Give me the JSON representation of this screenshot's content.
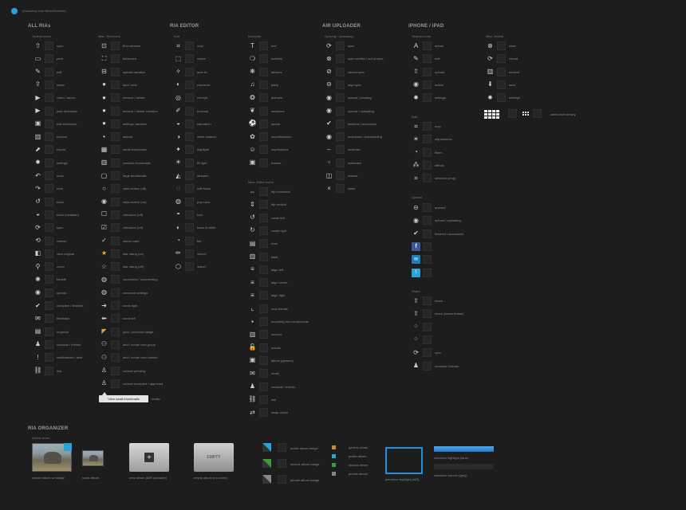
{
  "brand": {
    "logo_text": "photoshop.com Beta Elements",
    "accent": "#2aa3d8"
  },
  "sections": {
    "all_rias": "ALL RIAs",
    "ria_editor": "RIA EDITOR",
    "air_uploader": "AIR UPLOADER",
    "iphone_ipad": "iPHONE / iPAD",
    "ria_organizer": "RIA ORGANIZER"
  },
  "subsections": {
    "toolbar_icons": "Toolbar Icons",
    "misc_ria_icons": "Misc. RIA Icons",
    "edit": "Edit",
    "decorate": "Decorate",
    "misc_editor_icons": "Misc. Editor Icons",
    "syncing_uploading": "Syncing / Uploading",
    "iphone_toolbar_icons": "Toolbar Icons",
    "misc_mobile": "Misc. Mobile",
    "iphone_edit": "Edit",
    "iphone_upload": "Upload",
    "iphone_share": "Share",
    "album_icons": "Album Icons"
  },
  "toolbar_icons": [
    {
      "icon": "upload",
      "label": "sync"
    },
    {
      "icon": "print",
      "label": "print"
    },
    {
      "icon": "edit",
      "label": "edit"
    },
    {
      "icon": "share",
      "label": "share"
    },
    {
      "icon": "video-demo",
      "label": "video / demo"
    },
    {
      "icon": "play-slideshow",
      "label": "play slideshow"
    },
    {
      "icon": "edit-slideshow",
      "label": "edit slideshow"
    },
    {
      "icon": "remove",
      "label": "remove"
    },
    {
      "icon": "export",
      "label": "export"
    },
    {
      "icon": "settings",
      "label": "settings"
    },
    {
      "icon": "undo",
      "label": "undo"
    },
    {
      "icon": "redo",
      "label": "redo"
    },
    {
      "icon": "reset",
      "label": "reset"
    },
    {
      "icon": "reset-variation",
      "label": "reset (variation)"
    },
    {
      "icon": "sync",
      "label": "sync"
    },
    {
      "icon": "refresh",
      "label": "refresh"
    },
    {
      "icon": "view-original",
      "label": "view original"
    },
    {
      "icon": "zoom",
      "label": "zoom"
    },
    {
      "icon": "benefit",
      "label": "benefit"
    },
    {
      "icon": "upload-pending",
      "label": "upload"
    },
    {
      "icon": "complete",
      "label": "complete / finished"
    },
    {
      "icon": "feedback",
      "label": "feedback"
    },
    {
      "icon": "organize",
      "label": "organize"
    },
    {
      "icon": "contacts",
      "label": "contacts / friends"
    },
    {
      "icon": "notifications",
      "label": "notifications / alert"
    },
    {
      "icon": "link",
      "label": "link"
    }
  ],
  "misc_ria_icons": [
    {
      "icon": "fit-to-window",
      "label": "fit to window"
    },
    {
      "icon": "fullscreen",
      "label": "fullscreen"
    },
    {
      "icon": "upload-variation",
      "label": "upload variation"
    },
    {
      "icon": "add-new",
      "label": "add / new"
    },
    {
      "icon": "remove-delete",
      "label": "remove / delete"
    },
    {
      "icon": "remove-delete-variation",
      "label": "remove / delete variation"
    },
    {
      "icon": "settings-variation",
      "label": "settings variation"
    },
    {
      "icon": "search",
      "label": "search"
    },
    {
      "icon": "small-thumbnails",
      "label": "small thumbnails"
    },
    {
      "icon": "medium-thumbnails",
      "label": "medium thumbnails"
    },
    {
      "icon": "large-thumbnails",
      "label": "large thumbnails"
    },
    {
      "icon": "radio-button-off",
      "label": "radio button (off)"
    },
    {
      "icon": "radio-button-on",
      "label": "radio button (on)"
    },
    {
      "icon": "checkbox-off",
      "label": "checkbox (off)"
    },
    {
      "icon": "checkbox-on",
      "label": "checkbox (on)"
    },
    {
      "icon": "check-mark",
      "label": "check mark"
    },
    {
      "icon": "star-rating-on",
      "label": "star rating (on)"
    },
    {
      "icon": "star-rating-off",
      "label": "star rating (off)"
    },
    {
      "icon": "comments",
      "label": "comments / commenting"
    },
    {
      "icon": "comment-settings",
      "label": "comment settings"
    },
    {
      "icon": "scroll-right",
      "label": "scroll right"
    },
    {
      "icon": "scroll-left",
      "label": "scroll left"
    },
    {
      "icon": "plus-premium-badge",
      "label": "plus / premium badge"
    },
    {
      "icon": "add-create-group",
      "label": "add / create new group"
    },
    {
      "icon": "add-create-contact",
      "label": "add / create new contact"
    },
    {
      "icon": "contact-pending",
      "label": "contact pending"
    },
    {
      "icon": "contact-accepted",
      "label": "contact accepted / approved"
    }
  ],
  "edit_icons": [
    {
      "icon": "crop",
      "label": "crop"
    },
    {
      "icon": "resize",
      "label": "resize"
    },
    {
      "icon": "auto-fix",
      "label": "auto fix"
    },
    {
      "icon": "exposure",
      "label": "exposure"
    },
    {
      "icon": "red-eye",
      "label": "red eye"
    },
    {
      "icon": "touchup",
      "label": "touchup"
    },
    {
      "icon": "saturation",
      "label": "saturation"
    },
    {
      "icon": "white-balance",
      "label": "white balance"
    },
    {
      "icon": "highlight",
      "label": "highlight"
    },
    {
      "icon": "fill-light",
      "label": "fill light"
    },
    {
      "icon": "sharpen",
      "label": "sharpen"
    },
    {
      "icon": "soft-focus",
      "label": "soft focus"
    },
    {
      "icon": "pop-color",
      "label": "pop color"
    },
    {
      "icon": "hue",
      "label": "hue"
    },
    {
      "icon": "black-white",
      "label": "black & white"
    },
    {
      "icon": "tint",
      "label": "tint"
    },
    {
      "icon": "sketch",
      "label": "sketch"
    },
    {
      "icon": "distort",
      "label": "distort"
    }
  ],
  "decorate_icons": [
    {
      "icon": "text",
      "label": "text"
    },
    {
      "icon": "bubbles",
      "label": "bubbles"
    },
    {
      "icon": "stickers",
      "label": "stickers"
    },
    {
      "icon": "party",
      "label": "party"
    },
    {
      "icon": "animals",
      "label": "animals"
    },
    {
      "icon": "seafarms",
      "label": "seafarms"
    },
    {
      "icon": "sports",
      "label": "sports"
    },
    {
      "icon": "miscellaneous",
      "label": "miscellaneous"
    },
    {
      "icon": "expressions",
      "label": "expressions"
    },
    {
      "icon": "frames",
      "label": "frames"
    }
  ],
  "misc_editor_icons": [
    {
      "icon": "flip-horizontal",
      "label": "flip horizontal"
    },
    {
      "icon": "flip-vertical",
      "label": "flip vertical"
    },
    {
      "icon": "rotate-left",
      "label": "rotate left"
    },
    {
      "icon": "rotate-right",
      "label": "rotate right"
    },
    {
      "icon": "front",
      "label": "front"
    },
    {
      "icon": "back",
      "label": "back"
    },
    {
      "icon": "align-left",
      "label": "align left"
    },
    {
      "icon": "align-center",
      "label": "align center"
    },
    {
      "icon": "align-right",
      "label": "align right"
    },
    {
      "icon": "crop-handle",
      "label": "crop handle"
    },
    {
      "icon": "bounding-box",
      "label": "bounding box components"
    },
    {
      "icon": "remove",
      "label": "remove"
    },
    {
      "icon": "unlock",
      "label": "unlock"
    },
    {
      "icon": "album-generic",
      "label": "album (generic)"
    },
    {
      "icon": "email",
      "label": "email"
    },
    {
      "icon": "contacts-friends",
      "label": "contacts / friends"
    },
    {
      "icon": "link",
      "label": "link"
    },
    {
      "icon": "swap-colors",
      "label": "swap colors"
    }
  ],
  "syncing_icons": [
    {
      "icon": "sync",
      "label": "sync"
    },
    {
      "icon": "sync-conflict",
      "label": "sync conflict / out of sync"
    },
    {
      "icon": "cancel-sync",
      "label": "cancel sync"
    },
    {
      "icon": "stop-sync",
      "label": "stop sync"
    },
    {
      "icon": "upload-pending",
      "label": "upload / pending"
    },
    {
      "icon": "upload-uploading",
      "label": "upload / uploading"
    },
    {
      "icon": "finished-successful",
      "label": "finished / successful"
    },
    {
      "icon": "download-downloading",
      "label": "download / downloading"
    },
    {
      "icon": "minimize",
      "label": "minimize"
    },
    {
      "icon": "maximize",
      "label": "maximize"
    },
    {
      "icon": "restore",
      "label": "restore"
    },
    {
      "icon": "close",
      "label": "close"
    }
  ],
  "iphone_toolbar_icons": [
    {
      "icon": "adobe",
      "label": "adobe"
    },
    {
      "icon": "edit",
      "label": "edit"
    },
    {
      "icon": "upload",
      "label": "upload"
    },
    {
      "icon": "online",
      "label": "online"
    },
    {
      "icon": "settings",
      "label": "settings"
    }
  ],
  "misc_mobile_icons": [
    {
      "icon": "clear",
      "label": "clear"
    },
    {
      "icon": "reload",
      "label": "reload"
    },
    {
      "icon": "remove",
      "label": "remove"
    },
    {
      "icon": "save",
      "label": "save"
    },
    {
      "icon": "settings",
      "label": "settings"
    }
  ],
  "misc_mobile_grid_label": "select from library",
  "iphone_edit_icons": [
    {
      "icon": "crop",
      "label": "crop"
    },
    {
      "icon": "adjustments",
      "label": "adjustments"
    },
    {
      "icon": "filters",
      "label": "filters"
    },
    {
      "icon": "effects",
      "label": "effects"
    },
    {
      "icon": "selected-crop",
      "label": "selected (crop)"
    }
  ],
  "iphone_upload_icons": [
    {
      "icon": "queued",
      "label": "queued"
    },
    {
      "icon": "upload-uploading",
      "label": "upload / uploading"
    },
    {
      "icon": "finished-successful",
      "label": "finished / successful"
    },
    {
      "icon": "facebook",
      "label": ""
    },
    {
      "icon": "messenger",
      "label": ""
    },
    {
      "icon": "twitter",
      "label": ""
    }
  ],
  "iphone_share_icons": [
    {
      "icon": "share",
      "label": "share"
    },
    {
      "icon": "share-bottom",
      "label": "share (below button)"
    },
    {
      "icon": "blank-1",
      "label": ""
    },
    {
      "icon": "blank-2",
      "label": ""
    },
    {
      "icon": "sync",
      "label": "sync"
    },
    {
      "icon": "contacts-friends",
      "label": "contacts / friends"
    }
  ],
  "view_button": {
    "label": "View small thumbnails",
    "hint": "tooltip"
  },
  "organizer": {
    "simple_album": "simple album w/ badge",
    "small_album": "small album",
    "new_album": "new album (AIR Uploader)",
    "empty_album": "empty album (no cover)",
    "empty_text": "EMPTY",
    "public_badge": "public album badge",
    "shared_badge": "shared album badge",
    "private_badge": "private album badge",
    "generic_photo": "generic photo",
    "public_album": "public album",
    "shared_album": "shared album",
    "private_album": "private album",
    "highlight": "precision highlight (AIR)",
    "sel_highlight_blue": "selection highlight (blue)",
    "sel_rollover_grey": "selection rollover (grey)"
  }
}
